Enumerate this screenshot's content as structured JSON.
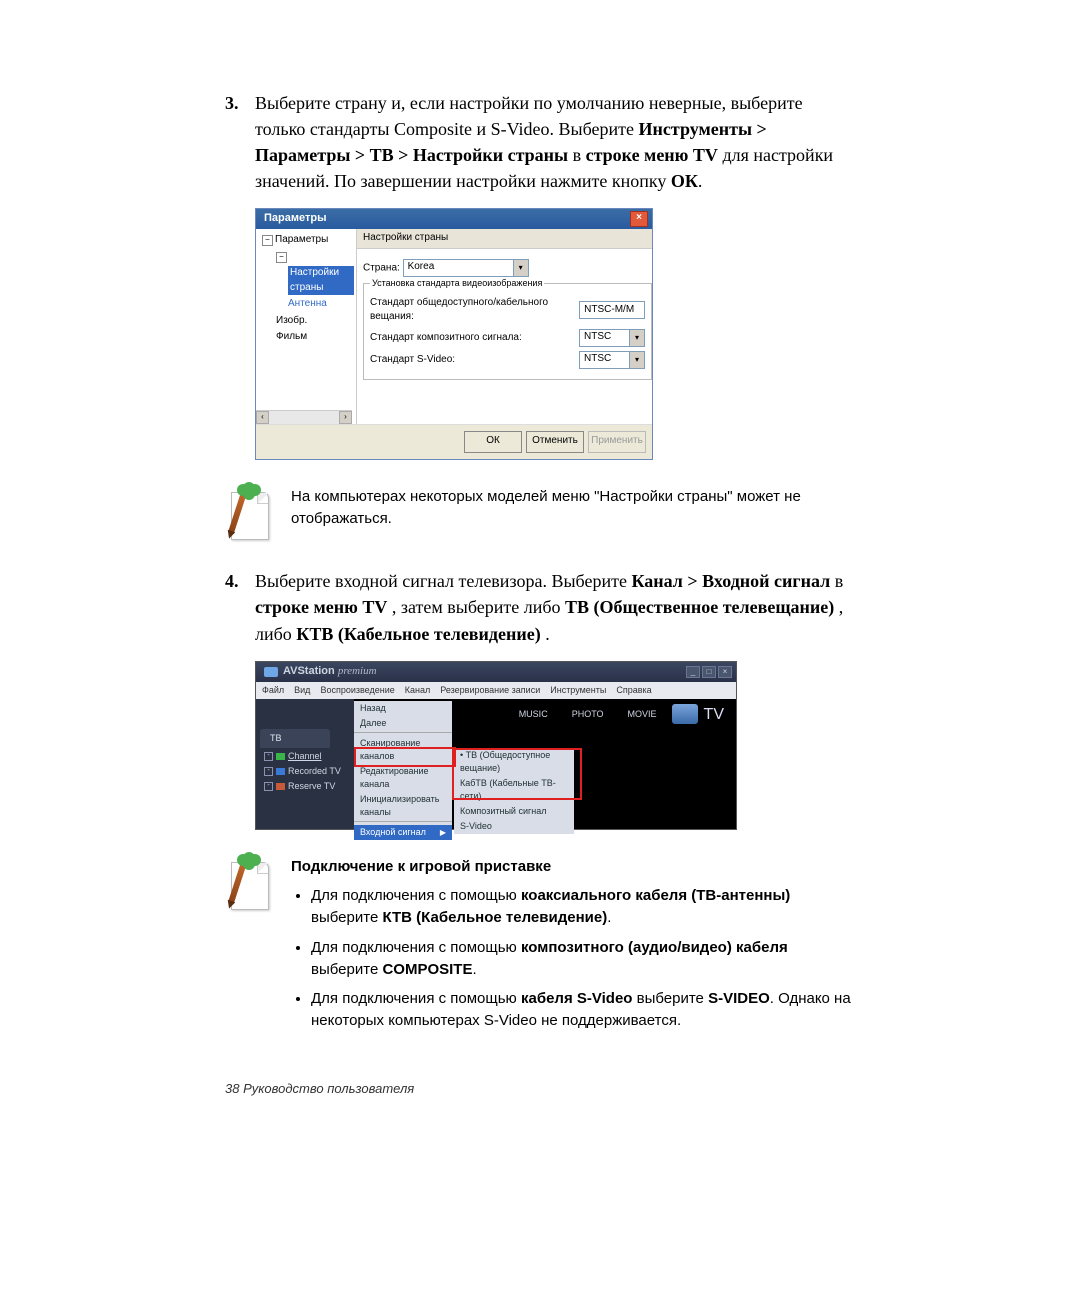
{
  "step3": {
    "num": "3.",
    "text_a": "Выберите страну и, если настройки по умолчанию неверные, выберите только стандарты Composite и S-Video. Выберите ",
    "path": "Инструменты > Параметры > ТВ > Настройки страны",
    "mid": " в ",
    "loc": "строке меню TV",
    "text_b": " для настройки значений. По завершении настройки нажмите кнопку ",
    "ok": "ОК",
    "dot": "."
  },
  "fig1": {
    "title": "Параметры",
    "tree": {
      "root": "Параметры",
      "children": [
        "Настройки страны",
        "Антенна",
        "Изобр.",
        "Фильм"
      ],
      "selected": 0,
      "toggle": "−"
    },
    "tab": "Настройки страны",
    "country_label": "Страна:",
    "country_value": "Korea",
    "fs_legend": "Установка стандарта видеоизображения",
    "rows": {
      "cable": {
        "label": "Стандарт общедоступного/кабельного вещания:",
        "value": "NTSC-M/M"
      },
      "composite": {
        "label": "Стандарт композитного сигнала:",
        "value": "NTSC"
      },
      "svideo": {
        "label": "Стандарт S-Video:",
        "value": "NTSC"
      }
    },
    "buttons": {
      "ok": "ОК",
      "cancel": "Отменить",
      "apply": "Применить"
    }
  },
  "note1": "На компьютерах некоторых моделей меню \"Настройки страны\" может не отображаться.",
  "step4": {
    "num": "4.",
    "a": "Выберите входной сигнал телевизора. Выберите ",
    "path": "Канал > Входной сигнал",
    "b": " в ",
    "loc": "строке меню TV",
    "c": ", затем выберите либо ",
    "opt1": "ТВ (Общественное телевещание)",
    "d": ", либо ",
    "opt2": "КТВ (Кабельное телевидение)",
    "e": "."
  },
  "fig2": {
    "app": "AVStation",
    "suffix": "premium",
    "menus": [
      "Файл",
      "Вид",
      "Воспроизведение",
      "Канал",
      "Резервирование записи",
      "Инструменты",
      "Справка"
    ],
    "tabs": [
      "MUSIC",
      "PHOTO",
      "MOVIE"
    ],
    "tvlabel": "TV",
    "side_tab": "ТВ",
    "side": [
      {
        "name": "Channel",
        "selected": true
      },
      {
        "name": "Recorded TV"
      },
      {
        "name": "Reserve TV"
      }
    ],
    "dd1": {
      "items": [
        "Назад",
        "Далее"
      ],
      "sep_items": [
        "Сканирование каналов",
        "Редактирование канала",
        "Инициализировать каналы"
      ],
      "hi": "Входной сигнал"
    },
    "dd2": [
      "ТВ (Общедоступное вещание)",
      "КабТВ (Кабельные ТВ-сети)",
      "Композитный сигнал",
      "S-Video"
    ]
  },
  "note2": {
    "heading": "Подключение к игровой приставке",
    "b1a": "Для подключения с помощью ",
    "b1b": "коаксиального кабеля (ТВ-антенны)",
    "b1c": " выберите ",
    "b1d": "КТВ (Кабельное телевидение)",
    "b1e": ".",
    "b2a": "Для подключения с помощью ",
    "b2b": "композитного (аудио/видео) кабеля",
    "b2c": " выберите ",
    "b2d": "COMPOSITE",
    "b2e": ".",
    "b3a": "Для подключения с помощью ",
    "b3b": "кабеля S-Video",
    "b3c": " выберите ",
    "b3d": "S-VIDEO",
    "b3e": ". Однако на некоторых компьютерах S-Video не поддерживается."
  },
  "footer": "38  Руководство пользователя"
}
